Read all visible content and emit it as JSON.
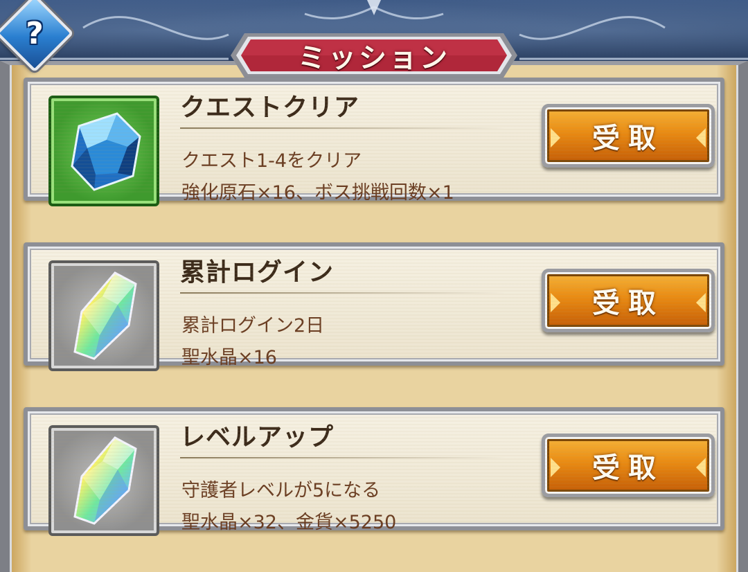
{
  "header": {
    "title": "ミッション",
    "help_glyph": "?",
    "help_icon": "help-question-icon"
  },
  "missions": [
    {
      "title": "クエストクリア",
      "description": "クエスト1-4をクリア",
      "reward": "強化原石×16、ボス挑戦回数×1",
      "icon": "blue-crystal-icon",
      "icon_frame": "green",
      "button_label": "受取"
    },
    {
      "title": "累計ログイン",
      "description": "累計ログイン2日",
      "reward": "聖水晶×16",
      "icon": "rainbow-crystal-icon",
      "icon_frame": "gray",
      "button_label": "受取"
    },
    {
      "title": "レベルアップ",
      "description": "守護者レベルが5になる",
      "reward": "聖水晶×32、金貨×5250",
      "icon": "rainbow-crystal-icon",
      "icon_frame": "gray",
      "button_label": "受取"
    }
  ],
  "colors": {
    "title_plate": "#b0273a",
    "button": "#e98a12",
    "card_bg": "#f3eddd",
    "text_title": "#3b2a1a",
    "text_body": "#6a3d22"
  }
}
